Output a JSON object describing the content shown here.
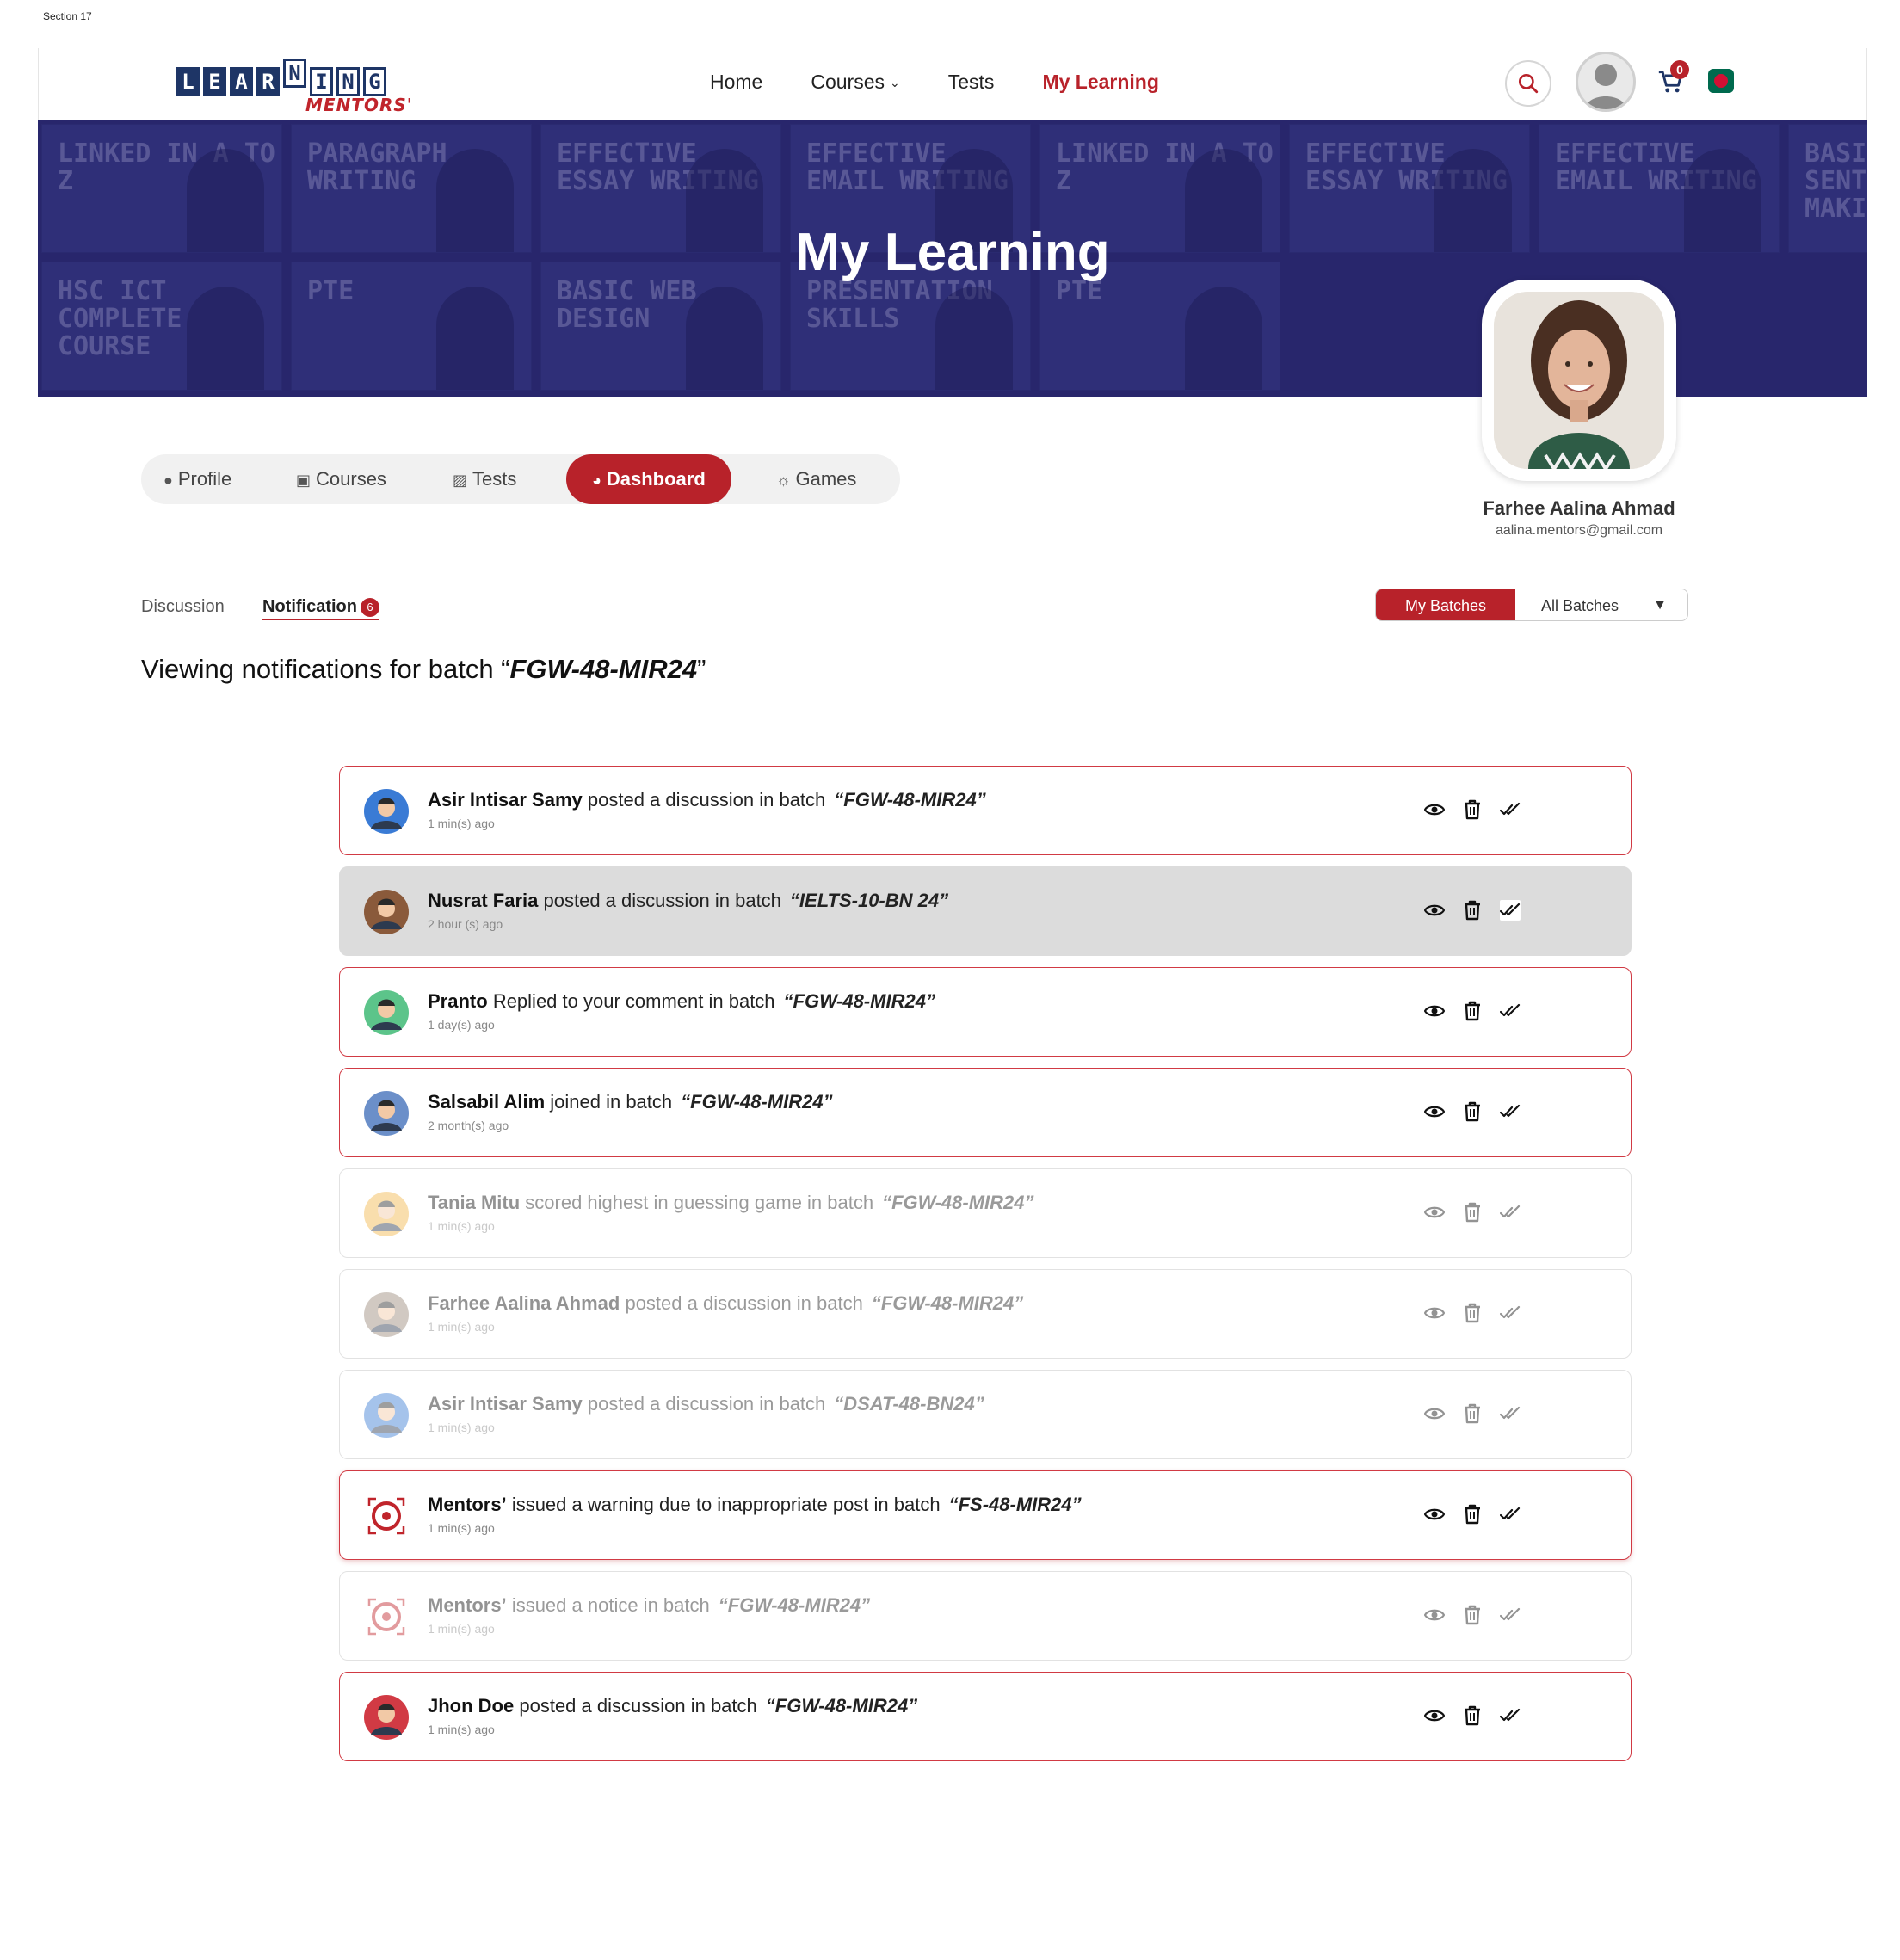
{
  "section_label": "Section 17",
  "logo": {
    "letters": [
      "L",
      "E",
      "A",
      "R",
      "N",
      "I",
      "N",
      "G"
    ],
    "sub": "MENTORS'"
  },
  "nav": {
    "home": "Home",
    "courses": "Courses",
    "tests": "Tests",
    "my_learning": "My Learning"
  },
  "cart_count": "0",
  "banner": {
    "title": "My Learning",
    "tiles": [
      "LINKED IN A TO Z",
      "PARAGRAPH WRITING",
      "EFFECTIVE ESSAY WRITING",
      "EFFECTIVE EMAIL WRITING",
      "LINKED IN A TO Z",
      "EFFECTIVE ESSAY WRITING",
      "EFFECTIVE EMAIL WRITING",
      "BASICS OF SENTENCE MAKING",
      "HSC ICT COMPLETE COURSE",
      "PTE",
      "BASIC WEB DESIGN",
      "PRESENTATION SKILLS",
      "PTE"
    ]
  },
  "profile": {
    "name": "Farhee Aalina Ahmad",
    "email": "aalina.mentors@gmail.com"
  },
  "tabs": {
    "profile": "Profile",
    "courses": "Courses",
    "tests": "Tests",
    "dashboard": "Dashboard",
    "games": "Games"
  },
  "subtabs": {
    "discussion": "Discussion",
    "notification": "Notification",
    "notification_count": "6"
  },
  "batch_toggle": {
    "my": "My Batches",
    "all": "All Batches"
  },
  "viewing": {
    "prefix": "Viewing notifications for batch “",
    "batch": "FGW-48-MIR24",
    "suffix": "”"
  },
  "notifications": [
    {
      "who": "Asir Intisar Samy",
      "action": "posted a discussion in batch",
      "batch": "“FGW-48-MIR24”",
      "time": "1 min(s) ago",
      "state": "unread",
      "avatar_color": "#3a7bd5"
    },
    {
      "who": "Nusrat Faria",
      "action": "posted a discussion in batch",
      "batch": "“IELTS-10-BN 24”",
      "time": "2 hour (s) ago",
      "state": "highlight",
      "avatar_color": "#8a5a3b"
    },
    {
      "who": "Pranto",
      "action": "Replied to your comment in batch",
      "batch": "“FGW-48-MIR24”",
      "time": "1 day(s) ago",
      "state": "unread",
      "avatar_color": "#5cc48a"
    },
    {
      "who": "Salsabil Alim",
      "action": "joined in batch",
      "batch": "“FGW-48-MIR24”",
      "time": "2 month(s) ago",
      "state": "unread",
      "avatar_color": "#6b8fc9"
    },
    {
      "who": "Tania Mitu",
      "action": "scored highest in guessing game in batch",
      "batch": "“FGW-48-MIR24”",
      "time": "1 min(s) ago",
      "state": "read",
      "avatar_color": "#f2b84b"
    },
    {
      "who": "Farhee Aalina Ahmad",
      "action": "posted a discussion in batch",
      "batch": "“FGW-48-MIR24”",
      "time": "1 min(s) ago",
      "state": "read",
      "avatar_color": "#9a8a7a"
    },
    {
      "who": "Asir Intisar Samy",
      "action": "posted a discussion in batch",
      "batch": "“DSAT-48-BN24”",
      "time": "1 min(s) ago",
      "state": "read",
      "avatar_color": "#3a7bd5"
    },
    {
      "who": "Mentors’",
      "action": "issued a warning due to inappropriate post in batch",
      "batch": "“FS-48-MIR24”",
      "time": "1 min(s) ago",
      "state": "warning",
      "avatar_color": "#c0242b"
    },
    {
      "who": "Mentors’",
      "action": "issued a notice in batch",
      "batch": "“FGW-48-MIR24”",
      "time": "1 min(s) ago",
      "state": "read",
      "avatar_color": "#c0242b"
    },
    {
      "who": "Jhon Doe",
      "action": "posted a discussion in batch",
      "batch": "“FGW-48-MIR24”",
      "time": "1 min(s) ago",
      "state": "unread",
      "avatar_color": "#d13a44"
    }
  ],
  "icons": {
    "view": "eye-icon",
    "delete": "trash-icon",
    "mark_read": "double-check-icon"
  },
  "colors": {
    "accent": "#b8222a",
    "brand_navy": "#1e3566"
  }
}
